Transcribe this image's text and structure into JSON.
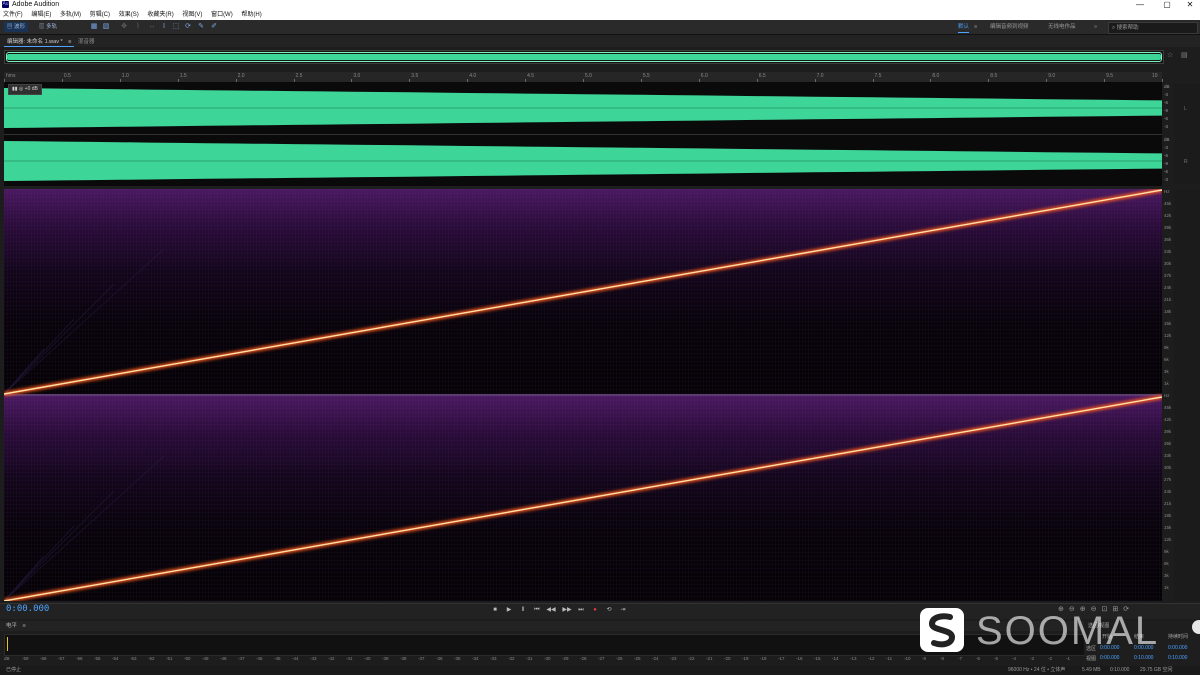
{
  "app": {
    "title": "Adobe Audition",
    "icon": "Au"
  },
  "menu": [
    "文件(F)",
    "编辑(E)",
    "多轨(M)",
    "剪辑(C)",
    "效果(S)",
    "收藏夹(R)",
    "视图(V)",
    "窗口(W)",
    "帮助(H)"
  ],
  "toolbar": {
    "waveform_btn": "波形",
    "multitrack_btn": "多轨",
    "workspaces": [
      "默认",
      "编辑音频到视频",
      "无线电作品"
    ],
    "search_placeholder": "搜索帮助"
  },
  "editor": {
    "tab": "编辑器: 未命名 1.wav *",
    "tab2": "混音器",
    "hud_gain": "+0 dB",
    "ruler_ticks": [
      "hms",
      "0.5",
      "1.0",
      "1.5",
      "2.0",
      "2.5",
      "3.0",
      "3.5",
      "4.0",
      "4.5",
      "5.0",
      "5.5",
      "6.0",
      "6.5",
      "7.0",
      "7.5",
      "8.0",
      "8.5",
      "9.0",
      "9.5",
      "10"
    ],
    "db_scale_top": [
      "dB",
      "-3",
      "-6",
      "-9",
      "-6",
      "-3"
    ],
    "db_scale_bottom": [
      "dB",
      "-3",
      "-6",
      "-9",
      "-6",
      "-3"
    ],
    "wave_color": "#3ed598",
    "wave_levels": {
      "start": 1.0,
      "end": 0.38
    },
    "freq_scale": [
      "Hz",
      "45k",
      "42k",
      "39k",
      "36k",
      "33k",
      "30k",
      "27k",
      "24k",
      "21k",
      "18k",
      "15k",
      "12k",
      "9k",
      "6k",
      "3k",
      "1k",
      "Hz",
      "45k",
      "42k",
      "39k",
      "36k",
      "33k",
      "30k",
      "27k",
      "24k",
      "21k",
      "18k",
      "15k",
      "12k",
      "9k",
      "6k",
      "3k",
      "1k"
    ],
    "sweep_color": "#ffd38a"
  },
  "transport": {
    "time": "0:00.000",
    "buttons": [
      "■",
      "▶",
      "Ⅱ",
      "⏮",
      "◀◀",
      "▶▶",
      "⏭",
      "●",
      "⟲",
      "⇥"
    ]
  },
  "levels": {
    "header": "电平",
    "scale": [
      "dB",
      "-59",
      "-58",
      "-57",
      "-56",
      "-55",
      "-54",
      "-53",
      "-52",
      "-51",
      "-50",
      "-49",
      "-48",
      "-47",
      "-46",
      "-45",
      "-44",
      "-43",
      "-42",
      "-41",
      "-40",
      "-39",
      "-38",
      "-37",
      "-36",
      "-35",
      "-34",
      "-33",
      "-32",
      "-31",
      "-30",
      "-29",
      "-28",
      "-27",
      "-26",
      "-25",
      "-24",
      "-23",
      "-22",
      "-21",
      "-20",
      "-19",
      "-18",
      "-17",
      "-16",
      "-15",
      "-14",
      "-13",
      "-12",
      "-11",
      "-10",
      "-9",
      "-8",
      "-7",
      "-6",
      "-5",
      "-4",
      "-3",
      "-2",
      "-1",
      "0"
    ]
  },
  "selection": {
    "header": "选区/视图",
    "col_headers": [
      "开始",
      "结束",
      "持续时间"
    ],
    "rows": [
      {
        "label": "选区",
        "start": "0:00.000",
        "end": "0:00.000",
        "dur": "0:00.000"
      },
      {
        "label": "视图",
        "start": "0:00.000",
        "end": "0:10.000",
        "dur": "0:10.000"
      }
    ]
  },
  "status": {
    "left": "已停止",
    "right": [
      "96000 Hz • 24 位 • 立体声",
      "5.49 MB",
      "0:10.000",
      "29.75 GB 空闲"
    ]
  },
  "watermark": "SOOMAL"
}
